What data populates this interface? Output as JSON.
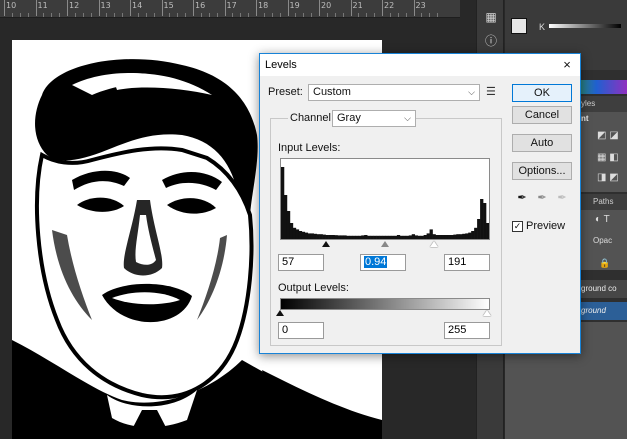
{
  "ruler": {
    "labels": [
      "10",
      "11",
      "12",
      "13",
      "14",
      "15",
      "16",
      "17",
      "18",
      "19",
      "20",
      "21",
      "22",
      "23"
    ]
  },
  "panels": {
    "color_channel": "K",
    "tab_styles": "yles",
    "tab_adjust": "nt",
    "tab_paths": "Paths",
    "opacity_label": "Opac",
    "layer_rows": [
      {
        "label": "kground co"
      },
      {
        "label": "kground"
      }
    ]
  },
  "dialog": {
    "title": "Levels",
    "close": "×",
    "preset_label": "Preset:",
    "preset_value": "Custom",
    "channel_label": "Channel:",
    "channel_value": "Gray",
    "input_levels_label": "Input Levels:",
    "input_black": "57",
    "input_gamma": "0.94",
    "input_white": "191",
    "output_levels_label": "Output Levels:",
    "output_black": "0",
    "output_white": "255",
    "ok_label": "OK",
    "cancel_label": "Cancel",
    "auto_label": "Auto",
    "options_label": "Options...",
    "preview_label": "Preview",
    "preview_checked": true
  },
  "histogram": {
    "values": [
      0.9,
      0.55,
      0.35,
      0.2,
      0.14,
      0.12,
      0.1,
      0.09,
      0.08,
      0.07,
      0.07,
      0.065,
      0.06,
      0.06,
      0.055,
      0.05,
      0.05,
      0.05,
      0.048,
      0.045,
      0.045,
      0.045,
      0.04,
      0.04,
      0.04,
      0.04,
      0.04,
      0.045,
      0.05,
      0.04,
      0.04,
      0.04,
      0.04,
      0.04,
      0.04,
      0.04,
      0.04,
      0.04,
      0.04,
      0.05,
      0.04,
      0.04,
      0.04,
      0.045,
      0.06,
      0.045,
      0.04,
      0.04,
      0.05,
      0.07,
      0.12,
      0.06,
      0.05,
      0.05,
      0.05,
      0.05,
      0.05,
      0.05,
      0.055,
      0.06,
      0.06,
      0.065,
      0.07,
      0.08,
      0.1,
      0.14,
      0.25,
      0.5,
      0.45,
      0.2
    ]
  }
}
